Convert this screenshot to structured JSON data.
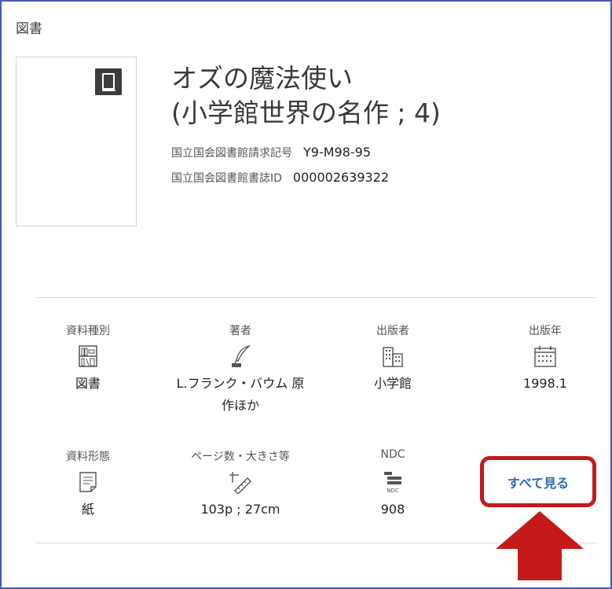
{
  "header": {
    "type_label": "図書"
  },
  "book": {
    "title_line1": "オズの魔法使い",
    "title_line2": "(小学館世界の名作 ; 4)",
    "call_number_label": "国立国会図書館請求記号",
    "call_number": "Y9-M98-95",
    "bib_id_label": "国立国会図書館書誌ID",
    "bib_id": "000002639322"
  },
  "details": {
    "material_type": {
      "label": "資料種別",
      "value": "図書",
      "icon": "bookshelf-icon"
    },
    "author": {
      "label": "著者",
      "value_line1": "L.フランク・バウム 原",
      "value_line2": "作ほか",
      "icon": "quill-pen-icon"
    },
    "publisher": {
      "label": "出版者",
      "value": "小学館",
      "icon": "building-icon"
    },
    "pub_year": {
      "label": "出版年",
      "value": "1998.1",
      "icon": "calendar-icon"
    },
    "material_form": {
      "label": "資料形態",
      "value": "紙",
      "icon": "paper-icon"
    },
    "pages_size": {
      "label": "ページ数・大きさ等",
      "value": "103p ; 27cm",
      "icon": "ruler-icon"
    },
    "ndc": {
      "label": "NDC",
      "value": "908",
      "icon": "ndc-icon",
      "icon_caption": "NDC"
    }
  },
  "actions": {
    "see_all_label": "すべて見る"
  },
  "colors": {
    "frame": "#4a56b8",
    "highlight": "#c41a1a",
    "link": "#2a6bb5"
  }
}
